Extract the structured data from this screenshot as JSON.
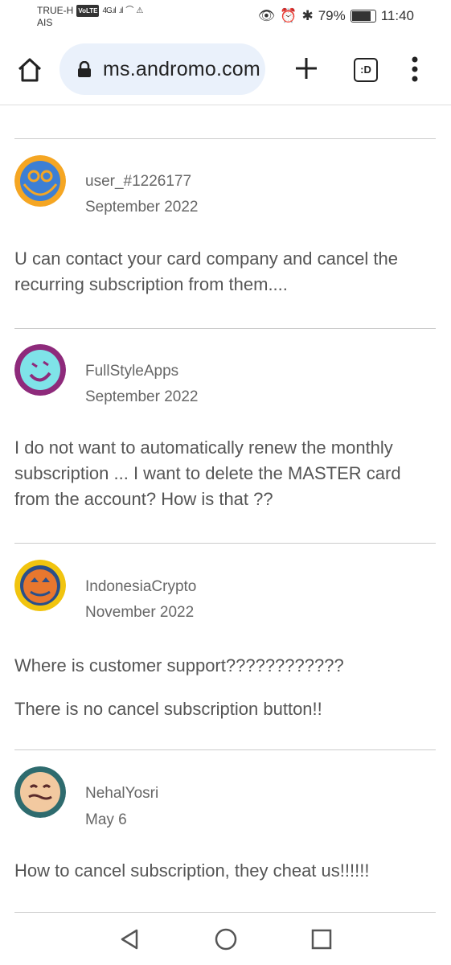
{
  "status_bar": {
    "carrier_top": "TRUE-H",
    "volte": "VoLTE",
    "network": "4G",
    "carrier_bottom": "AIS",
    "battery": "79%",
    "time": "11:40"
  },
  "browser": {
    "url": "ms.andromo.com",
    "tab_label": ":D"
  },
  "comments": [
    {
      "username": "user_#1226177",
      "date": "September 2022",
      "paragraphs": [
        "U can contact your card company and cancel the recurring subscription from them...."
      ],
      "avatar_color": "#f5a623"
    },
    {
      "username": "FullStyleApps",
      "date": "September 2022",
      "paragraphs": [
        "I do not want to automatically renew the monthly subscription ... I want to delete the MASTER card from the account? How is that ??"
      ],
      "avatar_color": "#8e2a7b"
    },
    {
      "username": "IndonesiaCrypto",
      "date": "November 2022",
      "paragraphs": [
        "Where is customer support????????????",
        "There is no cancel subscription button!!"
      ],
      "avatar_color": "#f1c40f"
    },
    {
      "username": "NehalYosri",
      "date": "May 6",
      "paragraphs": [
        "How to cancel subscription, they cheat us!!!!!!"
      ],
      "avatar_color": "#2e6b6e"
    }
  ]
}
